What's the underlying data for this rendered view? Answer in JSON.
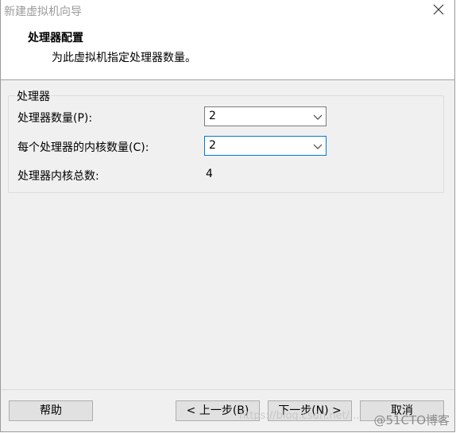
{
  "window": {
    "title": "新建虚拟机向导"
  },
  "header": {
    "title": "处理器配置",
    "subtitle": "为此虚拟机指定处理器数量。"
  },
  "group": {
    "title": "处理器",
    "processor_count": {
      "label": "处理器数量(P):",
      "value": "2"
    },
    "cores_per_processor": {
      "label": "每个处理器的内核数量(C):",
      "value": "2"
    },
    "total_cores": {
      "label": "处理器内核总数:",
      "value": "4"
    }
  },
  "buttons": {
    "help": "帮助",
    "back": "< 上一步(B)",
    "next": "下一步(N) >",
    "cancel": "取消"
  },
  "watermark": {
    "url": "https://blog.csdn.net/...",
    "brand": "@51CTO博客"
  }
}
